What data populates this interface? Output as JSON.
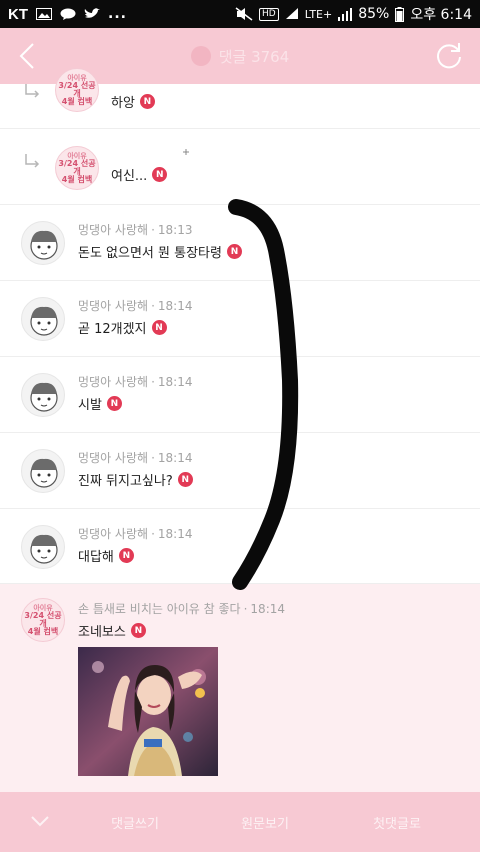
{
  "status_bar": {
    "carrier": "KT",
    "dots": "...",
    "network": "LTE+",
    "battery": "85%",
    "time": "오후 6:14",
    "hd": "HD"
  },
  "header": {
    "title": "댓글 3764"
  },
  "avatar_badge": {
    "line1": "아이유",
    "line2": "3/24 선공개",
    "line3": "4월 컴백"
  },
  "comments": [
    {
      "text": "하앙"
    },
    {
      "text": "여신..."
    },
    {
      "author": "멍댕아 사랑해",
      "time": "18:13",
      "text": "돈도 없으면서 뭔 통장타령"
    },
    {
      "author": "멍댕아 사랑해",
      "time": "18:14",
      "text": "곧 12개겠지"
    },
    {
      "author": "멍댕아 사랑해",
      "time": "18:14",
      "text": "시발"
    },
    {
      "author": "멍댕아 사랑해",
      "time": "18:14",
      "text": "진짜 뒤지고싶나?"
    },
    {
      "author": "멍댕아 사랑해",
      "time": "18:14",
      "text": "대답해"
    },
    {
      "author": "손 틈새로 비치는 아이유 참 좋다",
      "time": "18:14",
      "text": "조네보스"
    }
  ],
  "new_badge": "N",
  "bottom_bar": {
    "write": "댓글쓰기",
    "view_post": "원문보기",
    "first_comment": "첫댓글로"
  },
  "colors": {
    "header_pink": "#f7c9d3",
    "badge_red": "#e23a55",
    "highlight_row": "#fdeef1"
  },
  "icons": [
    "back-icon",
    "refresh-icon",
    "reply-arrow-icon",
    "chevron-down-icon",
    "new-badge-icon"
  ]
}
